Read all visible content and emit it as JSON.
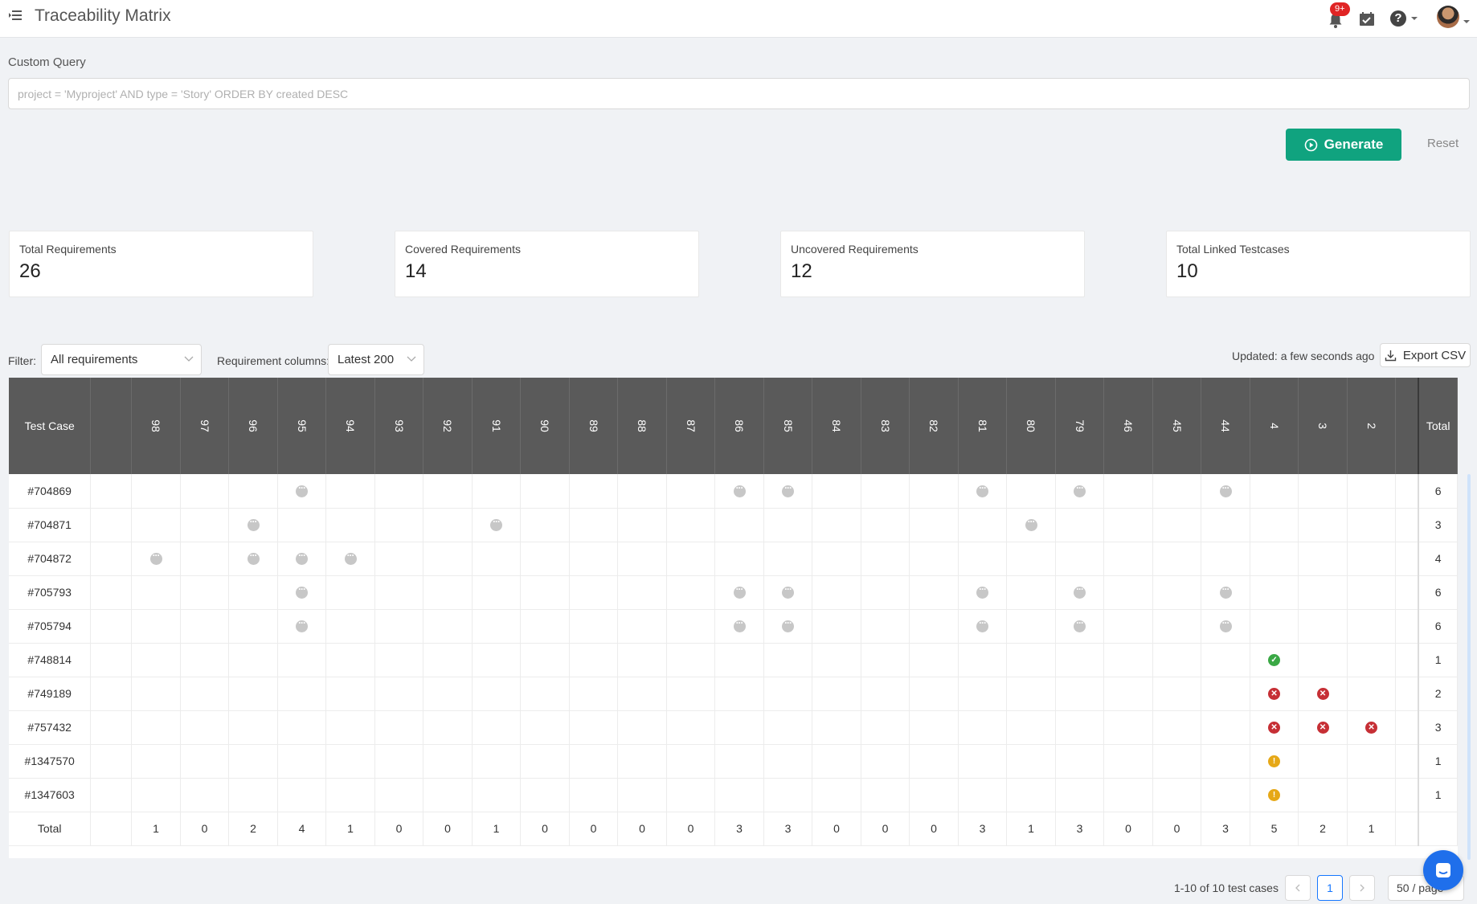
{
  "header": {
    "title": "Traceability Matrix",
    "notification_badge": "9+",
    "icons": [
      "menu-icon",
      "bell-icon",
      "calendar-check-icon",
      "help-icon",
      "avatar"
    ]
  },
  "query": {
    "label": "Custom Query",
    "placeholder": "project = 'Myproject' AND type = 'Story' ORDER BY created DESC",
    "value": ""
  },
  "actions": {
    "generate_label": "Generate",
    "reset_label": "Reset"
  },
  "stats": [
    {
      "label": "Total Requirements",
      "value": "26"
    },
    {
      "label": "Covered Requirements",
      "value": "14"
    },
    {
      "label": "Uncovered Requirements",
      "value": "12"
    },
    {
      "label": "Total Linked Testcases",
      "value": "10"
    }
  ],
  "filters": {
    "filter_label": "Filter:",
    "filter_value": "All requirements",
    "columns_label": "Requirement columns:",
    "columns_value": "Latest 200",
    "updated": "Updated: a few seconds ago",
    "export_label": "Export CSV"
  },
  "matrix": {
    "test_case_header": "Test Case",
    "total_header": "Total",
    "columns": [
      "98",
      "97",
      "96",
      "95",
      "94",
      "93",
      "92",
      "91",
      "90",
      "89",
      "88",
      "87",
      "86",
      "85",
      "84",
      "83",
      "82",
      "81",
      "80",
      "79",
      "46",
      "45",
      "44",
      "4",
      "3",
      "2"
    ],
    "rows": [
      {
        "id": "#704869",
        "marks": {
          "95": "dots",
          "86": "dots",
          "85": "dots",
          "81": "dots",
          "79": "dots",
          "44": "dots"
        },
        "total": "6"
      },
      {
        "id": "#704871",
        "marks": {
          "96": "dots",
          "91": "dots",
          "80": "dots"
        },
        "total": "3"
      },
      {
        "id": "#704872",
        "marks": {
          "98": "dots",
          "96": "dots",
          "95": "dots",
          "94": "dots"
        },
        "total": "4"
      },
      {
        "id": "#705793",
        "marks": {
          "95": "dots",
          "86": "dots",
          "85": "dots",
          "81": "dots",
          "79": "dots",
          "44": "dots"
        },
        "total": "6"
      },
      {
        "id": "#705794",
        "marks": {
          "95": "dots",
          "86": "dots",
          "85": "dots",
          "81": "dots",
          "79": "dots",
          "44": "dots"
        },
        "total": "6"
      },
      {
        "id": "#748814",
        "marks": {
          "4": "pass"
        },
        "total": "1"
      },
      {
        "id": "#749189",
        "marks": {
          "4": "fail",
          "3": "fail"
        },
        "total": "2"
      },
      {
        "id": "#757432",
        "marks": {
          "4": "fail",
          "3": "fail",
          "2": "fail"
        },
        "total": "3"
      },
      {
        "id": "#1347570",
        "marks": {
          "4": "warn"
        },
        "total": "1"
      },
      {
        "id": "#1347603",
        "marks": {
          "4": "warn"
        },
        "total": "1"
      }
    ],
    "totals_label": "Total",
    "column_totals": [
      "1",
      "0",
      "2",
      "4",
      "1",
      "0",
      "0",
      "1",
      "0",
      "0",
      "0",
      "0",
      "3",
      "3",
      "0",
      "0",
      "0",
      "3",
      "1",
      "3",
      "0",
      "0",
      "3",
      "5",
      "2",
      "1"
    ]
  },
  "pagination": {
    "summary": "1-10 of 10 test cases",
    "current_page": "1",
    "page_size": "50 / page"
  },
  "colors": {
    "accent": "#10a37f",
    "header_dark": "#5a5a5a",
    "pass": "#3aa845",
    "fail": "#c62f35",
    "warn": "#e6a817",
    "neutral": "#c7c7c7"
  }
}
